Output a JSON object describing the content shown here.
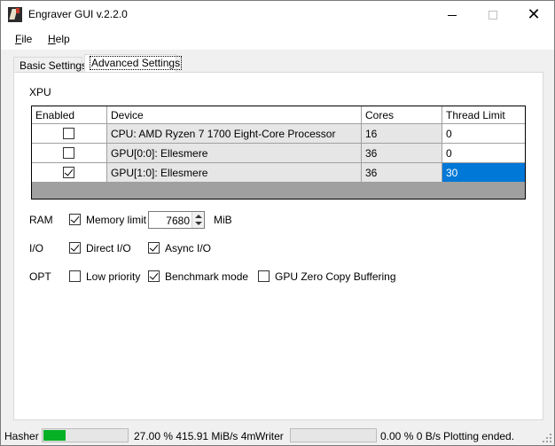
{
  "window": {
    "title": "Engraver GUI v.2.2.0",
    "icons": {
      "app": "engraver-app-icon",
      "minimize": "minimize-icon",
      "maximize": "maximize-icon",
      "close": "close-icon"
    }
  },
  "menu": {
    "file": {
      "accel": "F",
      "rest": "ile"
    },
    "help": {
      "accel": "H",
      "rest": "elp"
    }
  },
  "tabs": {
    "basic": "Basic Settings",
    "advanced": "Advanced Settings"
  },
  "xpu": {
    "label": "XPU",
    "columns": {
      "enabled": "Enabled",
      "device": "Device",
      "cores": "Cores",
      "limit": "Thread Limit"
    },
    "rows": [
      {
        "enabled": false,
        "device": "CPU: AMD Ryzen 7 1700 Eight-Core Processor",
        "cores": "16",
        "limit": "0",
        "selected": false
      },
      {
        "enabled": false,
        "device": "GPU[0:0]: Ellesmere",
        "cores": "36",
        "limit": "0",
        "selected": false
      },
      {
        "enabled": true,
        "device": "GPU[1:0]: Ellesmere",
        "cores": "36",
        "limit": "30",
        "selected": true
      }
    ]
  },
  "ram": {
    "label": "RAM",
    "memory_limit": {
      "label": "Memory limit",
      "checked": true
    },
    "value": "7680",
    "unit": "MiB"
  },
  "io": {
    "label": "I/O",
    "direct": {
      "label": "Direct I/O",
      "checked": true
    },
    "async": {
      "label": "Async I/O",
      "checked": true
    }
  },
  "opt": {
    "label": "OPT",
    "low_priority": {
      "label": "Low priority",
      "checked": false
    },
    "benchmark": {
      "label": "Benchmark mode",
      "checked": true
    },
    "zero_copy": {
      "label": "GPU Zero Copy Buffering",
      "checked": false
    }
  },
  "status": {
    "hasher_label": "Hasher",
    "hasher_progress": 0.27,
    "hasher_stats": "27.00 % 415.91 MiB/s 4m",
    "writer_label": "Writer",
    "writer_progress": 0.0,
    "writer_stats": "0.00 % 0 B/s",
    "message": "Plotting ended.",
    "colors": {
      "progress_fill": "#06b025",
      "selection": "#0078d7"
    }
  }
}
